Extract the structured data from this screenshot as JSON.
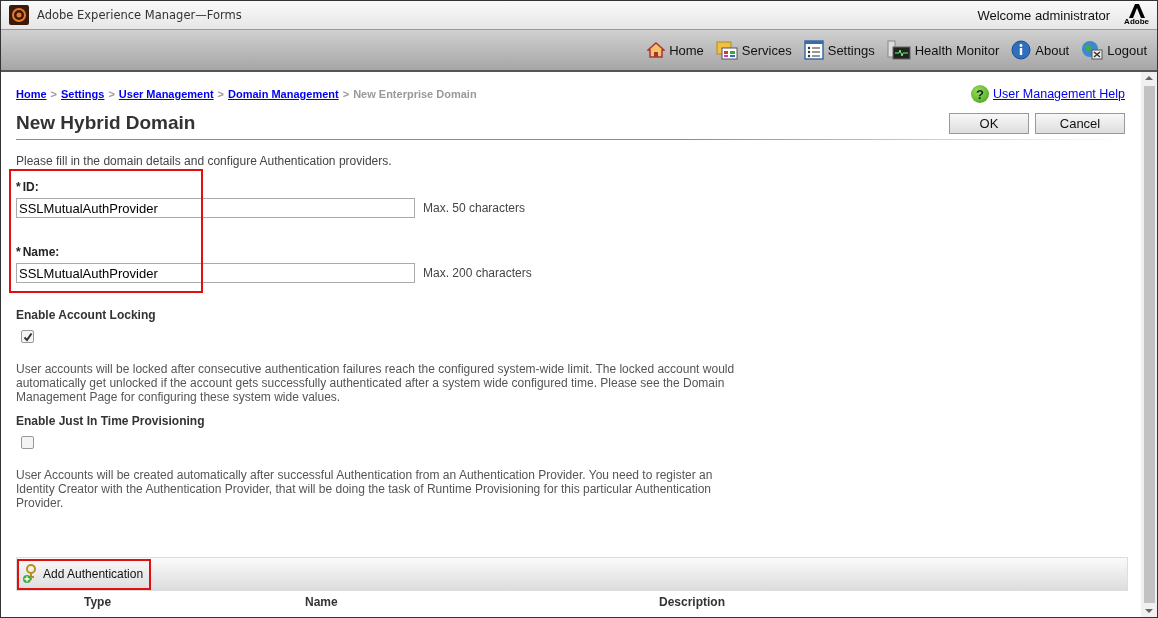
{
  "window": {
    "title": "Adobe Experience Manager—Forms",
    "welcome": "Welcome administrator",
    "logo_caption": "Adobe"
  },
  "nav": [
    {
      "label": "Home",
      "kind": "home"
    },
    {
      "label": "Services",
      "kind": "services"
    },
    {
      "label": "Settings",
      "kind": "settings"
    },
    {
      "label": "Health Monitor",
      "kind": "monitor"
    },
    {
      "label": "About",
      "kind": "about"
    },
    {
      "label": "Logout",
      "kind": "logout"
    }
  ],
  "breadcrumbs": [
    {
      "label": "Home",
      "link": true
    },
    {
      "label": "Settings",
      "link": true
    },
    {
      "label": "User Management",
      "link": true
    },
    {
      "label": "Domain Management",
      "link": true
    },
    {
      "label": "New Enterprise Domain",
      "link": false
    }
  ],
  "breadcrumb_separator": ">",
  "help_icon": "?",
  "help_link": "User Management Help",
  "title": "New Hybrid Domain",
  "buttons": [
    "OK",
    "Cancel"
  ],
  "intro": "Please fill in the domain details and configure Authentication providers.",
  "fields": [
    {
      "required_mark": "*",
      "label": "ID:",
      "value": "SSLMutualAuthProvider",
      "hint": "Max. 50 characters"
    },
    {
      "required_mark": "*",
      "label": "Name:",
      "value": "SSLMutualAuthProvider",
      "hint": "Max. 200 characters"
    }
  ],
  "options": [
    {
      "label": "Enable Account Locking",
      "checked": true,
      "description": "User accounts will be locked after consecutive authentication failures reach the configured system-wide limit. The locked account would automatically get unlocked if the account gets successfully authenticated after a system wide configured time. Please see the Domain Management Page for configuring these system wide values."
    },
    {
      "label": "Enable Just In Time Provisioning",
      "checked": false,
      "description": "User Accounts will be created automatically after successful Authentication from an Authentication Provider. You need to register an Identity Creator with the Authentication Provider, that will be doing the task of Runtime Provisioning for this particular Authentication Provider."
    }
  ],
  "add_button": "Add Authentication",
  "table": {
    "columns": [
      "Type",
      "Name",
      "Description"
    ]
  }
}
